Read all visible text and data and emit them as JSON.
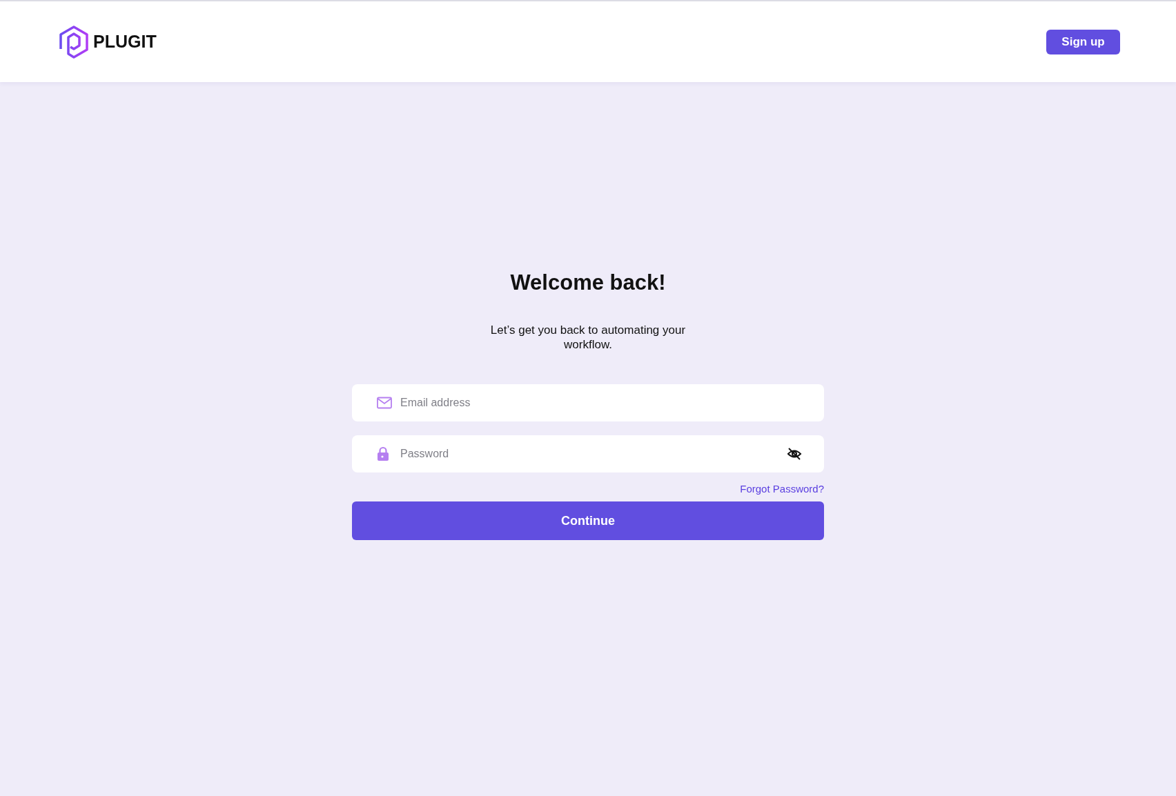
{
  "header": {
    "brand": "PLUGIT",
    "signup_button": "Sign up"
  },
  "login": {
    "title": "Welcome back!",
    "subtitle": "Let’s get you back to automating your workflow.",
    "email": {
      "placeholder": "Email address"
    },
    "password": {
      "placeholder": "Password"
    },
    "forgot_link": "Forgot Password?",
    "continue_button": "Continue"
  }
}
